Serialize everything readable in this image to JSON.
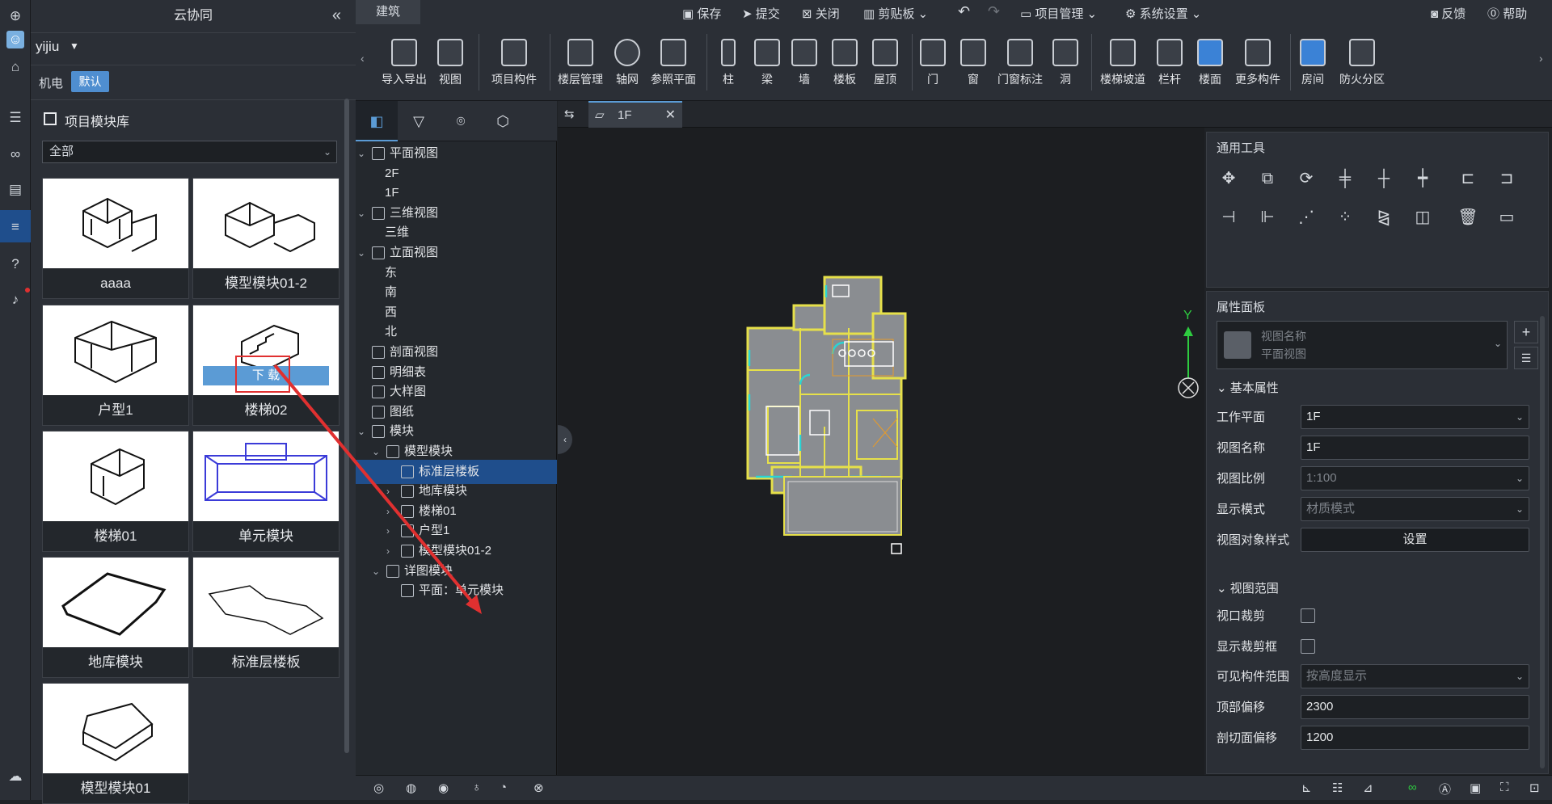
{
  "sidebar": {
    "title": "云协同",
    "collapse_icon": "«",
    "user": "yijiu",
    "discipline": "机电",
    "default_badge": "默认",
    "library_title": "项目模块库",
    "filter_value": "全部",
    "modules": [
      {
        "label": "aaaa"
      },
      {
        "label": "模型模块01-2"
      },
      {
        "label": "户型1"
      },
      {
        "label": "楼梯02"
      },
      {
        "label": "楼梯01"
      },
      {
        "label": "单元模块"
      },
      {
        "label": "地库模块"
      },
      {
        "label": "标准层楼板"
      },
      {
        "label": "模型模块01"
      }
    ],
    "download_label": "下 载"
  },
  "topbar": {
    "mode": "建筑",
    "save": "保存",
    "submit": "提交",
    "close": "关闭",
    "clipboard": "剪贴板",
    "project_mgmt": "项目管理",
    "system_settings": "系统设置",
    "feedback": "反馈",
    "help": "帮助"
  },
  "ribbon": {
    "items": [
      "导入导出",
      "视图",
      "项目构件",
      "楼层管理",
      "轴网",
      "参照平面",
      "柱",
      "梁",
      "墙",
      "楼板",
      "屋顶",
      "门",
      "窗",
      "门窗标注",
      "洞",
      "楼梯坡道",
      "栏杆",
      "楼面",
      "更多构件",
      "房间",
      "防火分区"
    ]
  },
  "tree": {
    "items": [
      {
        "label": "平面视图"
      },
      {
        "label": "2F"
      },
      {
        "label": "1F"
      },
      {
        "label": "三维视图"
      },
      {
        "label": "三维"
      },
      {
        "label": "立面视图"
      },
      {
        "label": "东"
      },
      {
        "label": "南"
      },
      {
        "label": "西"
      },
      {
        "label": "北"
      },
      {
        "label": "剖面视图"
      },
      {
        "label": "明细表"
      },
      {
        "label": "大样图"
      },
      {
        "label": "图纸"
      },
      {
        "label": "模块"
      },
      {
        "label": "模型模块"
      },
      {
        "label": "标准层楼板"
      },
      {
        "label": "地库模块"
      },
      {
        "label": "楼梯01"
      },
      {
        "label": "户型1"
      },
      {
        "label": "模型模块01-2"
      },
      {
        "label": "详图模块"
      },
      {
        "label": "平面：单元模块"
      }
    ]
  },
  "tab": {
    "label": "1F"
  },
  "viewport": {
    "axis_y": "Y"
  },
  "tools": {
    "title": "通用工具"
  },
  "props": {
    "title": "属性面板",
    "view_name_label": "视图名称",
    "view_type": "平面视图",
    "basic_section": "基本属性",
    "work_plane_label": "工作平面",
    "work_plane": "1F",
    "view_name_field_label": "视图名称",
    "view_name": "1F",
    "scale_label": "视图比例",
    "scale": "1:100",
    "display_mode_label": "显示模式",
    "display_mode": "材质模式",
    "object_style_label": "视图对象样式",
    "settings_button": "设置",
    "range_section": "视图范围",
    "crop_label": "视口裁剪",
    "show_crop_label": "显示裁剪框",
    "visible_range_label": "可见构件范围",
    "visible_range": "按高度显示",
    "top_offset_label": "顶部偏移",
    "top_offset": "2300",
    "cut_offset_label": "剖切面偏移",
    "cut_offset": "1200"
  },
  "colors": {
    "accent": "#5b9bd5",
    "selected": "#1f4e8c",
    "wall": "#e6e04a",
    "annotation": "#e03030"
  }
}
